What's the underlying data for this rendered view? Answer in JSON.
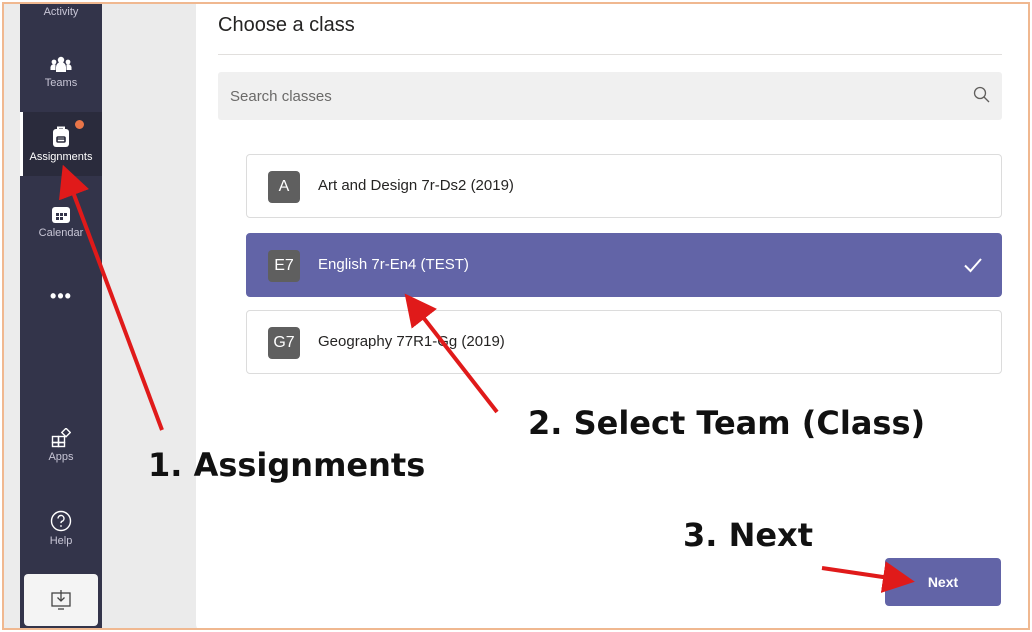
{
  "rail": {
    "items": [
      {
        "label": "Activity"
      },
      {
        "label": "Teams"
      },
      {
        "label": "Assignments"
      },
      {
        "label": "Calendar"
      },
      {
        "label": "•••"
      },
      {
        "label": "Apps"
      },
      {
        "label": "Help"
      }
    ]
  },
  "panel": {
    "title": "Choose a class",
    "search_placeholder": "Search classes",
    "classes": [
      {
        "badge": "A",
        "name": "Art and Design 7r-Ds2 (2019)",
        "selected": false
      },
      {
        "badge": "E7",
        "name": "English 7r-En4 (TEST)",
        "selected": true
      },
      {
        "badge": "G7",
        "name": "Geography 77R1-Gg (2019)",
        "selected": false
      }
    ],
    "next_label": "Next"
  },
  "annotations": {
    "step1": "1. Assignments",
    "step2": "2. Select Team (Class)",
    "step3": "3. Next"
  },
  "colors": {
    "rail_bg": "#33344a",
    "accent": "#6264a7",
    "arrow": "#e01a1a",
    "notification": "#e97548"
  }
}
